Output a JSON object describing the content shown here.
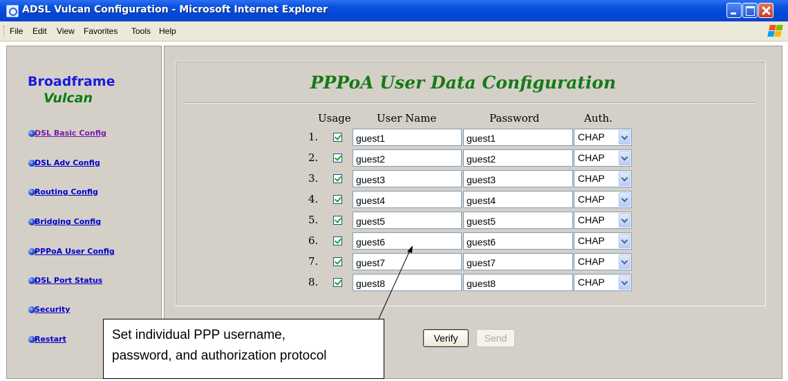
{
  "window": {
    "title": "ADSL Vulcan Configuration - Microsoft Internet Explorer",
    "menu": [
      "File",
      "Edit",
      "View",
      "Favorites",
      "Tools",
      "Help"
    ]
  },
  "sidebar": {
    "brand_line1": "Broadframe",
    "brand_line2": "Vulcan",
    "items": [
      {
        "label": "DSL Basic Config"
      },
      {
        "label": "DSL Adv Config"
      },
      {
        "label": "Routing Config"
      },
      {
        "label": "Bridging Config"
      },
      {
        "label": "PPPoA User Config"
      },
      {
        "label": "DSL Port Status"
      },
      {
        "label": "Security"
      },
      {
        "label": "Restart"
      }
    ]
  },
  "main": {
    "title": "PPPoA User Data Configuration",
    "headers": {
      "usage": "Usage",
      "user_name": "User Name",
      "password": "Password",
      "auth": "Auth."
    },
    "rows": [
      {
        "num": "1.",
        "usage": true,
        "user": "guest1",
        "password": "guest1",
        "auth": "CHAP"
      },
      {
        "num": "2.",
        "usage": true,
        "user": "guest2",
        "password": "guest2",
        "auth": "CHAP"
      },
      {
        "num": "3.",
        "usage": true,
        "user": "guest3",
        "password": "guest3",
        "auth": "CHAP"
      },
      {
        "num": "4.",
        "usage": true,
        "user": "guest4",
        "password": "guest4",
        "auth": "CHAP"
      },
      {
        "num": "5.",
        "usage": true,
        "user": "guest5",
        "password": "guest5",
        "auth": "CHAP"
      },
      {
        "num": "6.",
        "usage": true,
        "user": "guest6",
        "password": "guest6",
        "auth": "CHAP"
      },
      {
        "num": "7.",
        "usage": true,
        "user": "guest7",
        "password": "guest7",
        "auth": "CHAP"
      },
      {
        "num": "8.",
        "usage": true,
        "user": "guest8",
        "password": "guest8",
        "auth": "CHAP"
      }
    ],
    "verify_label": "Verify",
    "send_label": "Send"
  },
  "callout": {
    "line1": "Set individual PPP username,",
    "line2": "password, and authorization protocol"
  },
  "colors": {
    "titlebar": "#0a54e0",
    "frame": "#d4d0c8",
    "brand_blue": "#1a1adc",
    "brand_green": "#0b7a15",
    "title_green": "#167a16",
    "link": "#0000cc"
  }
}
